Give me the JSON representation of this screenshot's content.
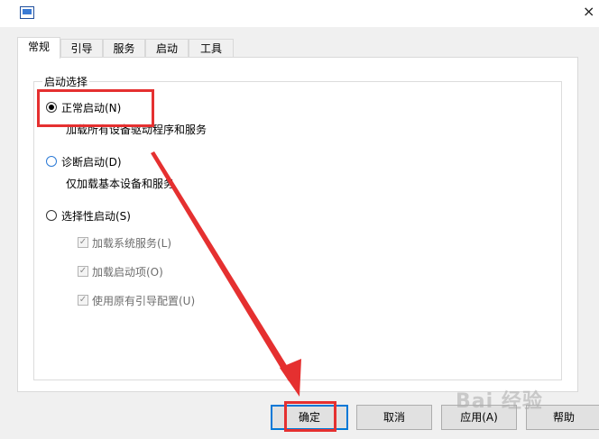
{
  "window": {
    "close_glyph": "×"
  },
  "tabs": [
    {
      "label": "常规"
    },
    {
      "label": "引导"
    },
    {
      "label": "服务"
    },
    {
      "label": "启动"
    },
    {
      "label": "工具"
    }
  ],
  "startup": {
    "group_label": "启动选择",
    "normal": {
      "label": "正常启动(N)",
      "desc": "加载所有设备驱动程序和服务",
      "selected": true
    },
    "diagnostic": {
      "label": "诊断启动(D)",
      "desc": "仅加载基本设备和服务",
      "selected": false
    },
    "selective": {
      "label": "选择性启动(S)",
      "selected": false,
      "options": [
        {
          "label": "加载系统服务(L)",
          "checked": true,
          "enabled": false
        },
        {
          "label": "加载启动项(O)",
          "checked": true,
          "enabled": false
        },
        {
          "label": "使用原有引导配置(U)",
          "checked": true,
          "enabled": false
        }
      ]
    }
  },
  "buttons": {
    "ok": "确定",
    "cancel": "取消",
    "apply": "应用(A)",
    "help": "帮助"
  },
  "watermark": "Bai 经验",
  "colors": {
    "annotation": "#e53030",
    "accent": "#0078d7"
  }
}
